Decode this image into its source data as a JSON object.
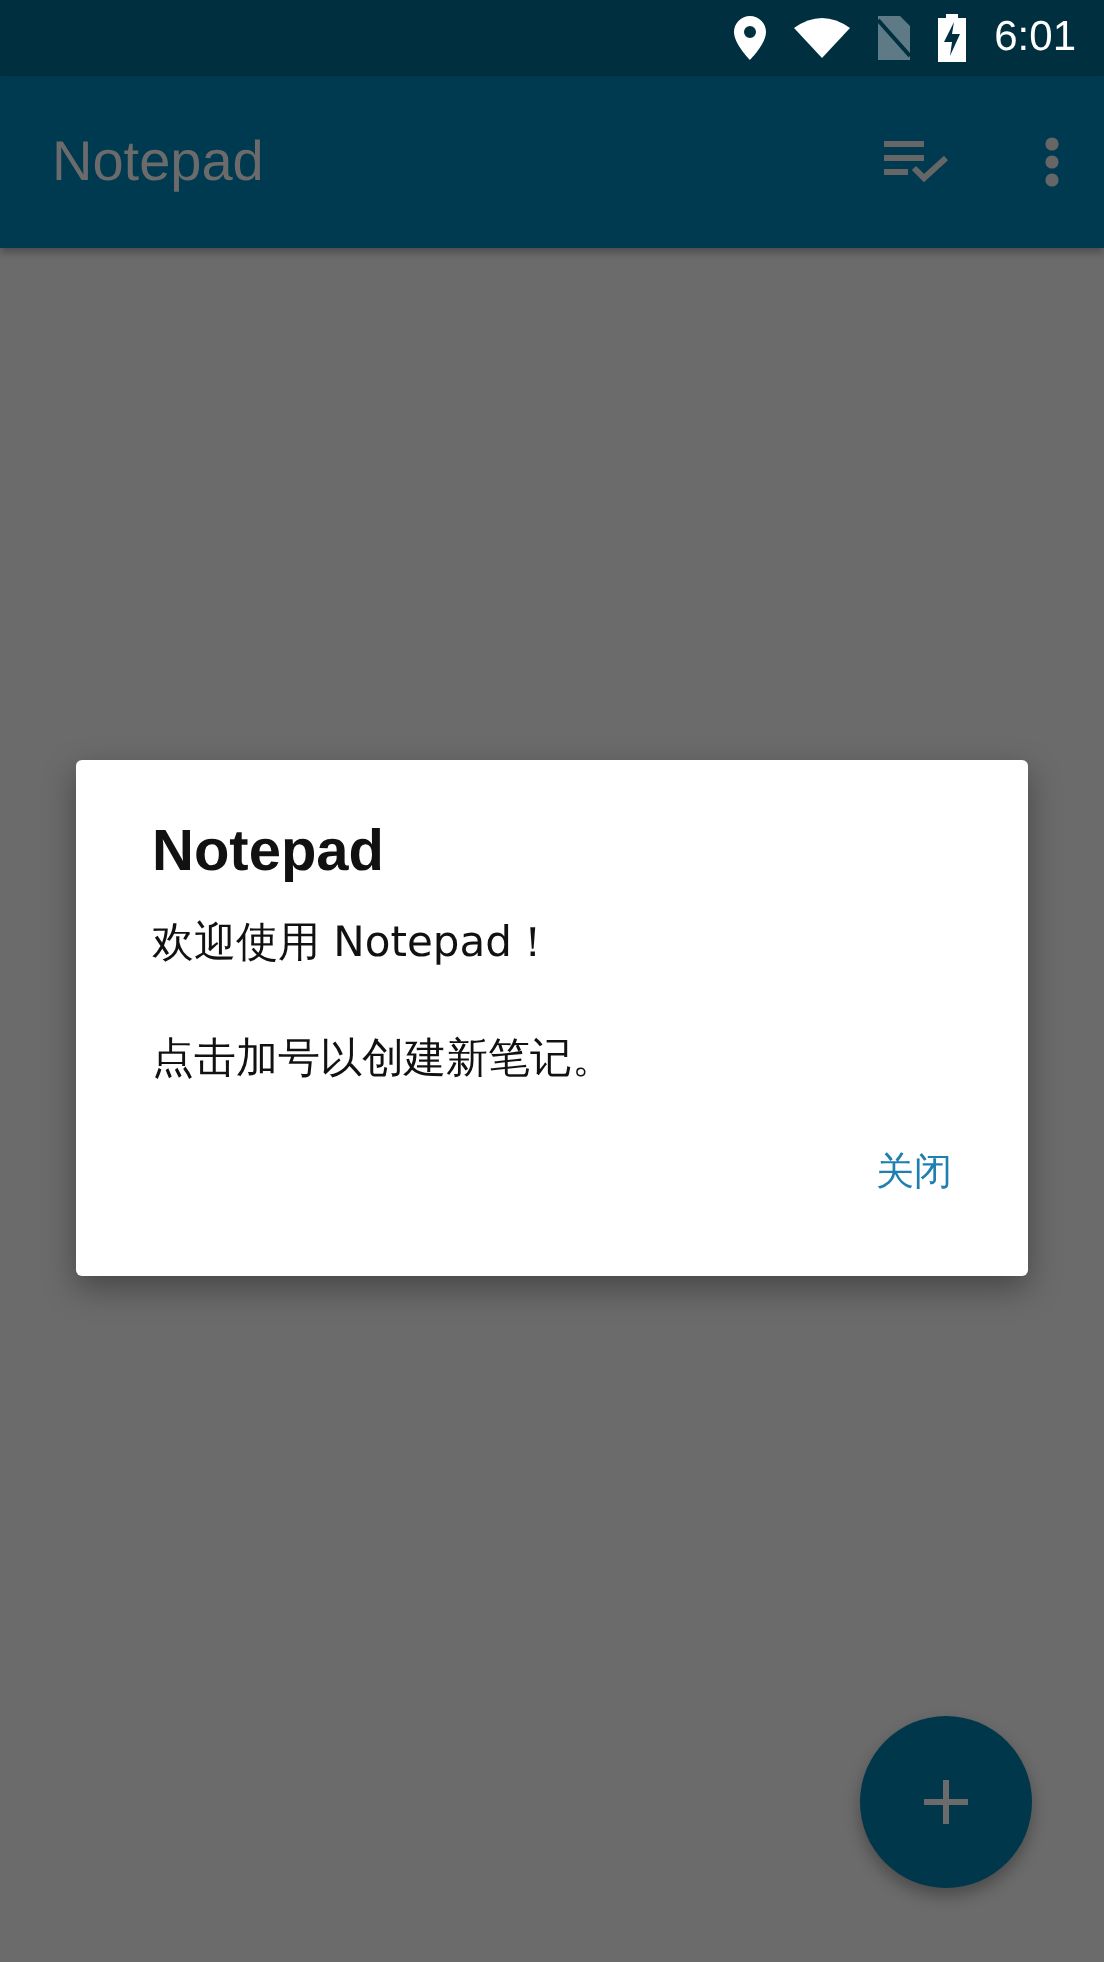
{
  "status_bar": {
    "time": "6:01"
  },
  "app_bar": {
    "title": "Notepad"
  },
  "dialog": {
    "title": "Notepad",
    "paragraphs": [
      "欢迎使用 Notepad！",
      "点击加号以创建新笔记。"
    ],
    "buttons": [
      "关闭"
    ]
  }
}
